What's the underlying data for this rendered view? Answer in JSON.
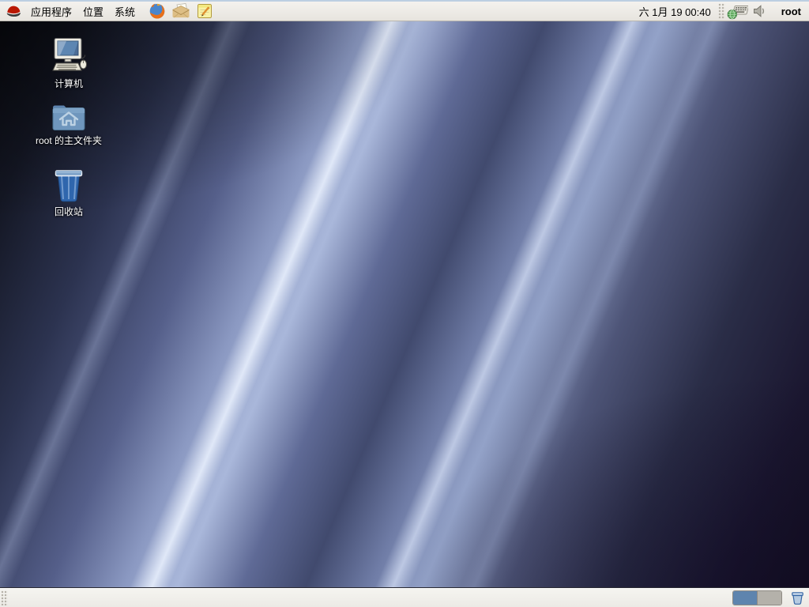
{
  "top_panel": {
    "logo_menu": {
      "icon": "redhat-logo-icon"
    },
    "menus": [
      {
        "label": "应用程序"
      },
      {
        "label": "位置"
      },
      {
        "label": "系统"
      }
    ],
    "launchers": [
      {
        "name": "firefox",
        "icon": "firefox-icon"
      },
      {
        "name": "email-client",
        "icon": "email-envelope-icon"
      },
      {
        "name": "text-editor",
        "icon": "text-editor-icon"
      }
    ],
    "clock": "六 1月 19 00:40",
    "indicators": [
      {
        "name": "keyboard-input-method",
        "icon": "keyboard-globe-icon"
      },
      {
        "name": "volume",
        "icon": "speaker-icon"
      }
    ],
    "username": "root"
  },
  "desktop": {
    "icons": [
      {
        "label": "计算机",
        "icon": "computer-icon"
      },
      {
        "label": "root 的主文件夹",
        "icon": "home-folder-icon"
      },
      {
        "label": "回收站",
        "icon": "trash-icon"
      }
    ]
  },
  "bottom_panel": {
    "workspace_switcher": {
      "count": 2,
      "active_index": 0
    },
    "trash_applet": {
      "icon": "trash-applet-icon"
    }
  },
  "colors": {
    "panel_bg": "#ece9e3",
    "panel_top_line": "#bccfe2",
    "active_workspace": "#5e84ae",
    "inactive_workspace": "#b4b1aa",
    "wallpaper_highlight": "#a9b7da",
    "wallpaper_dark": "#0a0b11"
  }
}
